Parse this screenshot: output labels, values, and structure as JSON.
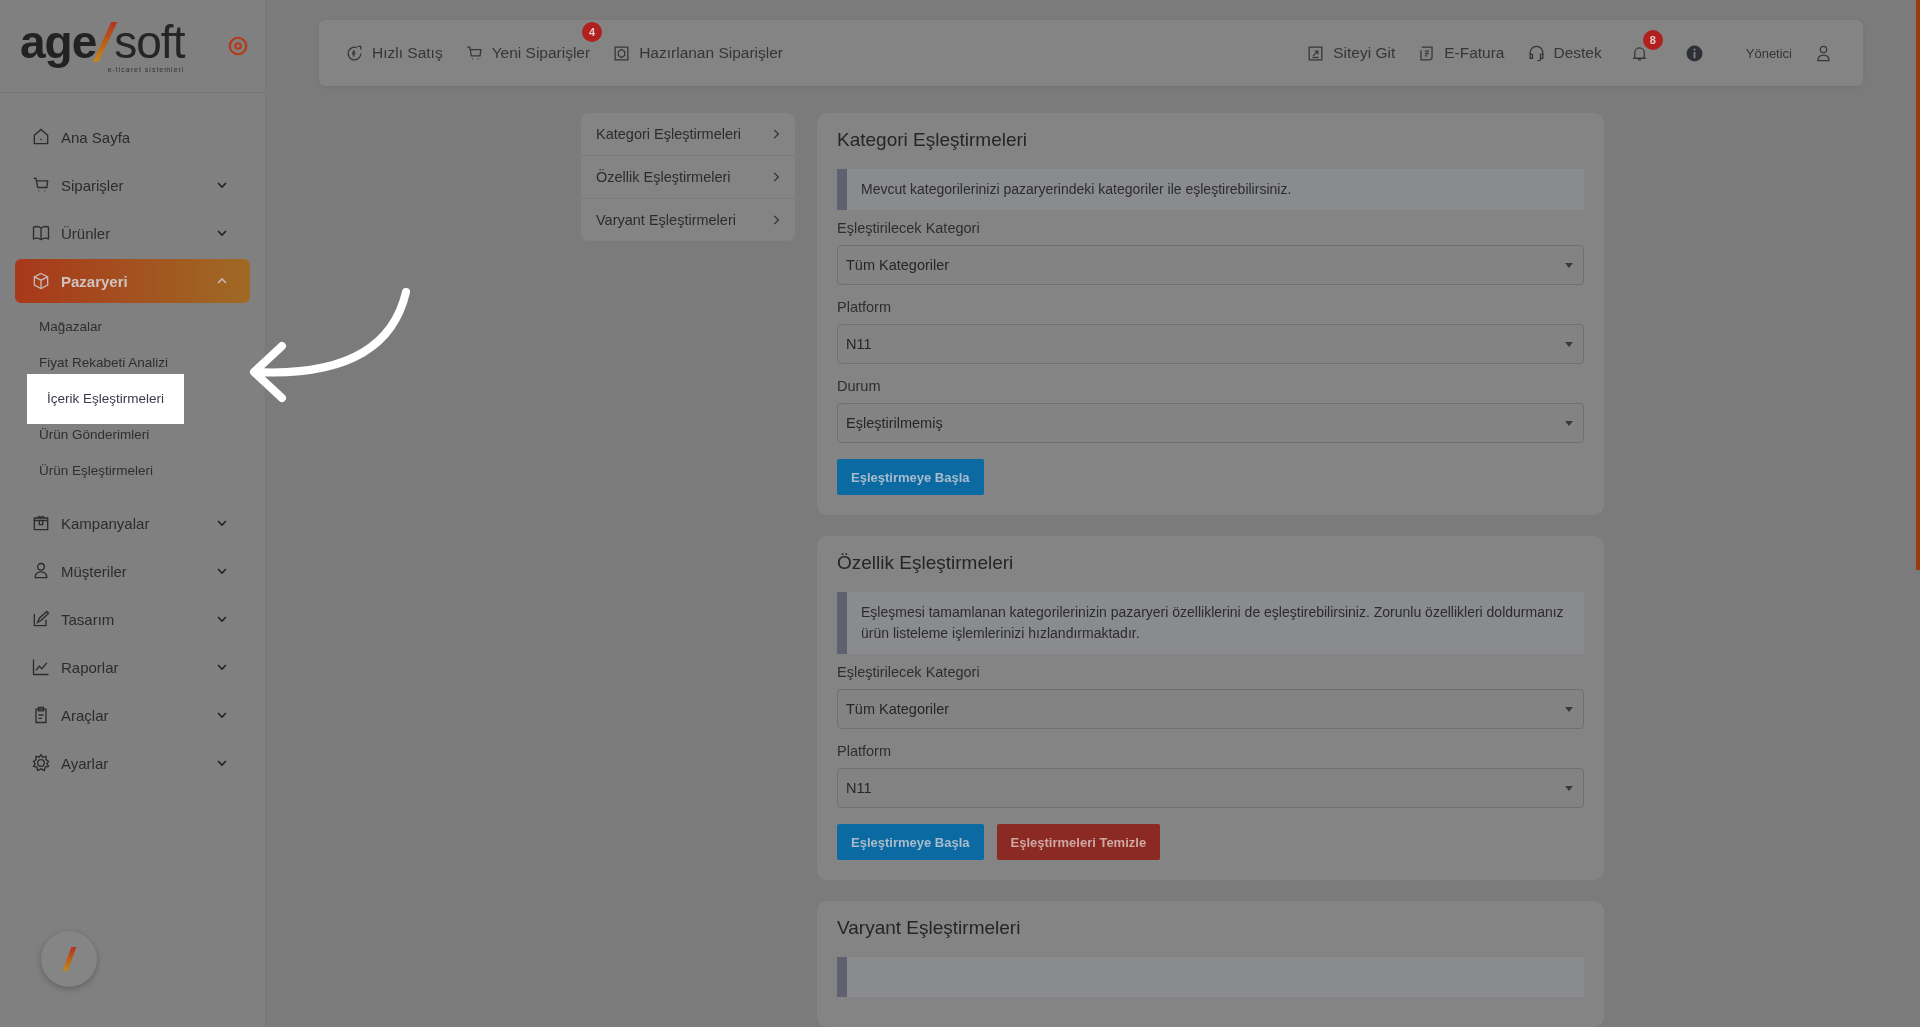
{
  "logo": {
    "part1": "age",
    "part2": "soft",
    "tagline": "e-ticaret sistemleri"
  },
  "sidebar": {
    "items": [
      {
        "label": "Ana Sayfa",
        "kind": "link",
        "selected": false
      },
      {
        "label": "Siparişler",
        "kind": "group",
        "selected": false,
        "expanded": false
      },
      {
        "label": "Ürünler",
        "kind": "group",
        "selected": false,
        "expanded": false
      },
      {
        "label": "Pazaryeri",
        "kind": "group",
        "selected": true,
        "expanded": true,
        "children": [
          {
            "label": "Mağazalar",
            "highlighted": false
          },
          {
            "label": "Fiyat Rekabeti Analizi",
            "highlighted": false
          },
          {
            "label": "İçerik Eşleştirmeleri",
            "highlighted": true
          },
          {
            "label": "Ürün Gönderimleri",
            "highlighted": false
          },
          {
            "label": "Ürün Eşleştirmeleri",
            "highlighted": false
          }
        ]
      },
      {
        "label": "Kampanyalar",
        "kind": "group",
        "selected": false,
        "expanded": false
      },
      {
        "label": "Müşteriler",
        "kind": "group",
        "selected": false,
        "expanded": false
      },
      {
        "label": "Tasarım",
        "kind": "group",
        "selected": false,
        "expanded": false
      },
      {
        "label": "Raporlar",
        "kind": "group",
        "selected": false,
        "expanded": false
      },
      {
        "label": "Araçlar",
        "kind": "group",
        "selected": false,
        "expanded": false
      },
      {
        "label": "Ayarlar",
        "kind": "group",
        "selected": false,
        "expanded": false
      }
    ]
  },
  "topbar": {
    "links": [
      {
        "label": "Hızlı Satış"
      },
      {
        "label": "Yeni Siparişler",
        "badge": "4"
      },
      {
        "label": "Hazırlanan Siparişler"
      }
    ],
    "right_links": [
      {
        "label": "Siteyi Git"
      },
      {
        "label": "E-Fatura"
      },
      {
        "label": "Destek"
      }
    ],
    "notification_badge": "8",
    "user": "Yönetici"
  },
  "subnav": [
    {
      "label": "Kategori Eşleştirmeleri"
    },
    {
      "label": "Özellik Eşleştirmeleri"
    },
    {
      "label": "Varyant Eşleştirmeleri"
    }
  ],
  "cards": [
    {
      "title": "Kategori Eşleştirmeleri",
      "info": "Mevcut kategorilerinizi pazaryerindeki kategoriler ile eşleştirebilirsiniz.",
      "fields": [
        {
          "label": "Eşleştirilecek Kategori",
          "value": "Tüm Kategoriler"
        },
        {
          "label": "Platform",
          "value": "N11"
        },
        {
          "label": "Durum",
          "value": "Eşleştirilmemiş"
        }
      ],
      "buttons": [
        {
          "label": "Eşleştirmeye Başla",
          "kind": "primary"
        }
      ]
    },
    {
      "title": "Özellik Eşleştirmeleri",
      "info": "Eşleşmesi tamamlanan kategorilerinizin pazaryeri özelliklerini de eşleştirebilirsiniz. Zorunlu özellikleri doldurmanız ürün listeleme işlemlerinizi hızlandırmaktadır.",
      "fields": [
        {
          "label": "Eşleştirilecek Kategori",
          "value": "Tüm Kategoriler"
        },
        {
          "label": "Platform",
          "value": "N11"
        }
      ],
      "buttons": [
        {
          "label": "Eşleştirmeye Başla",
          "kind": "primary"
        },
        {
          "label": "Eşleştirmeleri Temizle",
          "kind": "danger"
        }
      ]
    },
    {
      "title": "Varyant Eşleştirmeleri"
    }
  ]
}
